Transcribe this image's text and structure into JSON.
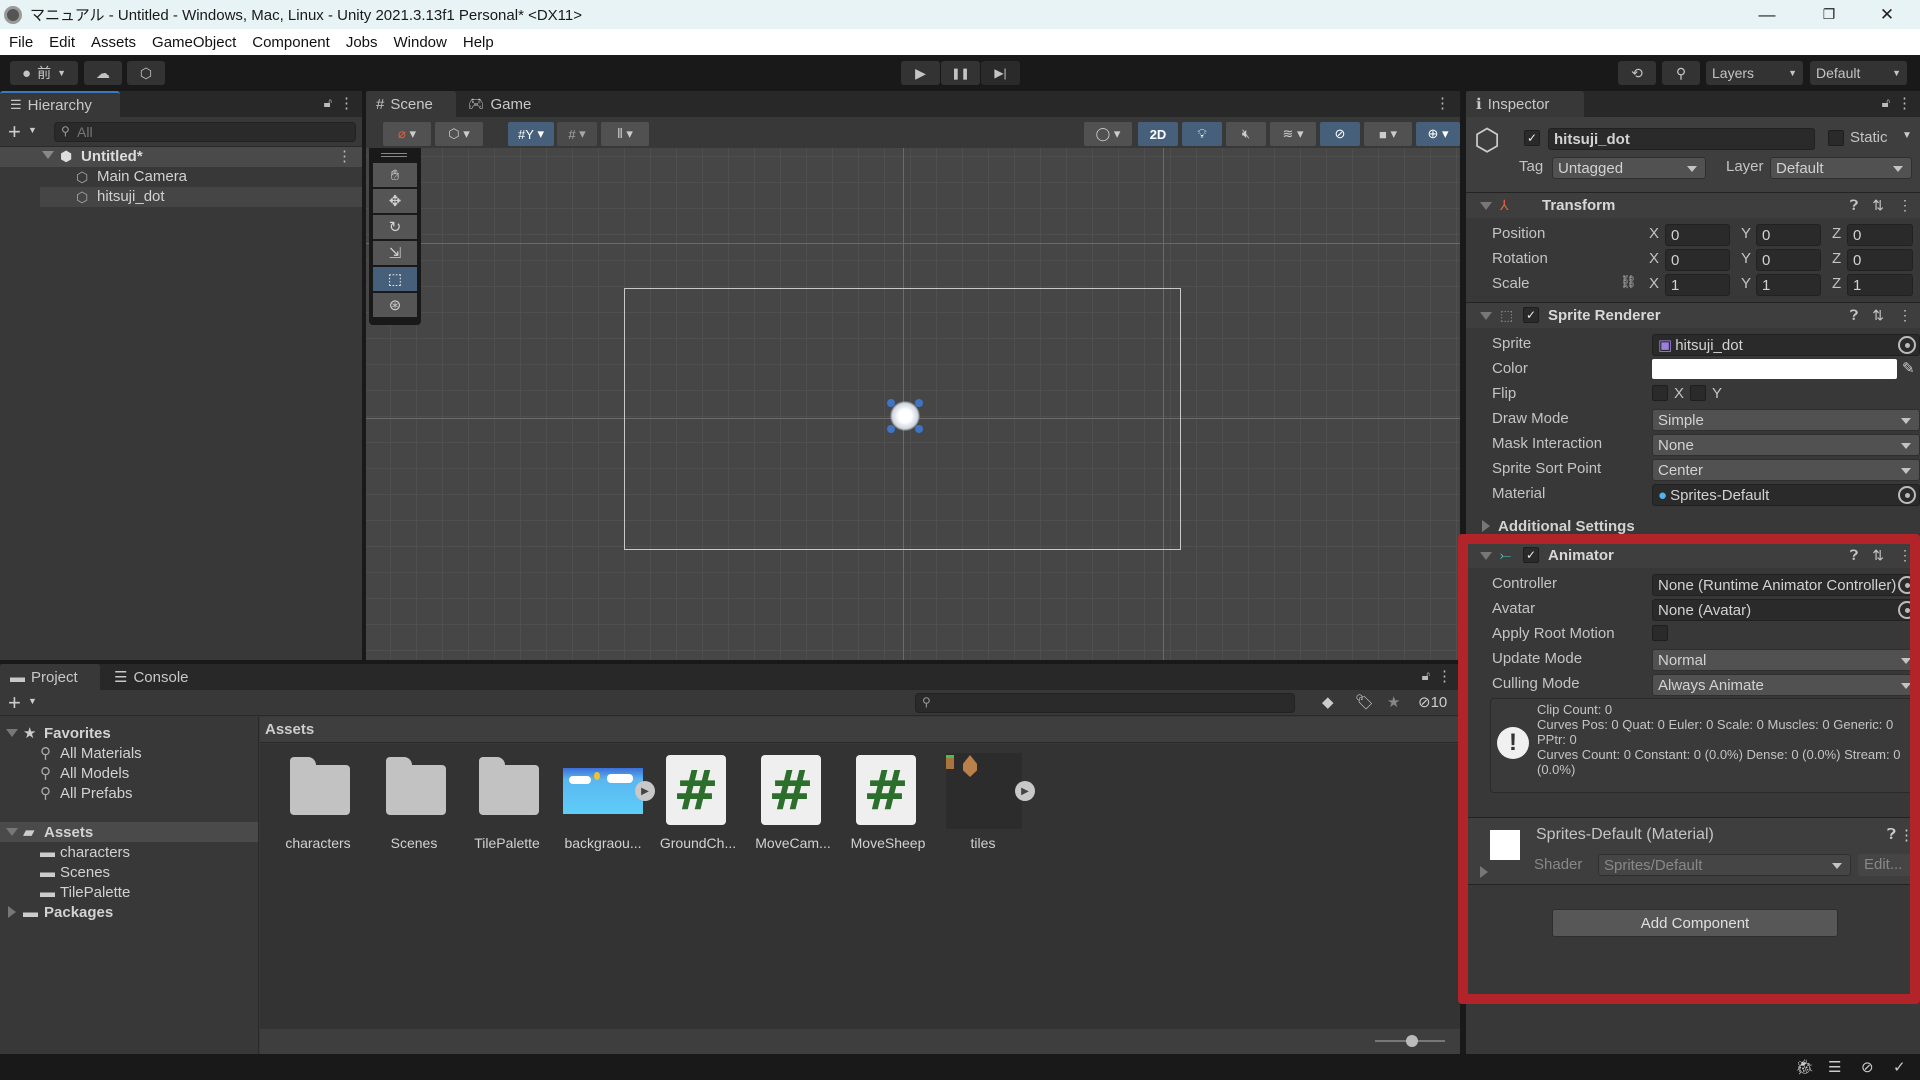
{
  "window": {
    "title": "マニュアル - Untitled - Windows, Mac, Linux - Unity 2021.3.13f1 Personal* <DX11>",
    "controls": {
      "minimize": "—",
      "restore": "❐",
      "close": "✕"
    }
  },
  "menu": [
    "File",
    "Edit",
    "Assets",
    "GameObject",
    "Component",
    "Jobs",
    "Window",
    "Help"
  ],
  "toolbar": {
    "account_label": "前",
    "play": "▶",
    "pause": "❚❚",
    "step": "▶|",
    "layers_label": "Layers",
    "layout_label": "Default"
  },
  "hierarchy": {
    "tab_label": "Hierarchy",
    "search_placeholder": "All",
    "scene_name": "Untitled*",
    "items": [
      "Main Camera",
      "hitsuji_dot"
    ]
  },
  "scene": {
    "tabs": [
      "Scene",
      "Game"
    ],
    "toggle_2d": "2D"
  },
  "project": {
    "tabs": [
      "Project",
      "Console"
    ],
    "hidden_count": "10",
    "favorites_label": "Favorites",
    "favorites": [
      "All Materials",
      "All Models",
      "All Prefabs"
    ],
    "assets_root": "Assets",
    "asset_folders": [
      "characters",
      "Scenes",
      "TilePalette"
    ],
    "packages_label": "Packages",
    "breadcrumb": "Assets",
    "grid_items": [
      {
        "name": "characters",
        "type": "folder"
      },
      {
        "name": "Scenes",
        "type": "folder"
      },
      {
        "name": "TilePalette",
        "type": "folder"
      },
      {
        "name": "backgraou...",
        "type": "sprite"
      },
      {
        "name": "GroundCh...",
        "type": "script"
      },
      {
        "name": "MoveCam...",
        "type": "script"
      },
      {
        "name": "MoveSheep",
        "type": "script"
      },
      {
        "name": "tiles",
        "type": "sprite"
      }
    ]
  },
  "inspector": {
    "tab_label": "Inspector",
    "object_name": "hitsuji_dot",
    "static_label": "Static",
    "tag_label": "Tag",
    "tag_value": "Untagged",
    "layer_label": "Layer",
    "layer_value": "Default",
    "transform": {
      "title": "Transform",
      "rows": [
        {
          "label": "Position",
          "x": "0",
          "y": "0",
          "z": "0"
        },
        {
          "label": "Rotation",
          "x": "0",
          "y": "0",
          "z": "0"
        },
        {
          "label": "Scale",
          "x": "1",
          "y": "1",
          "z": "1"
        }
      ]
    },
    "sprite_renderer": {
      "title": "Sprite Renderer",
      "sprite_label": "Sprite",
      "sprite_value": "hitsuji_dot",
      "color_label": "Color",
      "color_value": "#ffffff",
      "flip_label": "Flip",
      "flip_x": "X",
      "flip_y": "Y",
      "draw_mode_label": "Draw Mode",
      "draw_mode_value": "Simple",
      "mask_label": "Mask Interaction",
      "mask_value": "None",
      "sort_label": "Sprite Sort Point",
      "sort_value": "Center",
      "material_label": "Material",
      "material_value": "Sprites-Default",
      "additional_label": "Additional Settings"
    },
    "animator": {
      "title": "Animator",
      "controller_label": "Controller",
      "controller_value": "None (Runtime Animator Controller)",
      "avatar_label": "Avatar",
      "avatar_value": "None (Avatar)",
      "root_motion_label": "Apply Root Motion",
      "update_mode_label": "Update Mode",
      "update_mode_value": "Normal",
      "culling_label": "Culling Mode",
      "culling_value": "Always Animate",
      "info_lines": [
        "Clip Count: 0",
        "Curves Pos: 0 Quat: 0 Euler: 0 Scale: 0 Muscles: 0 Generic: 0 PPtr: 0",
        "Curves Count: 0 Constant: 0 (0.0%) Dense: 0 (0.0%) Stream: 0 (0.0%)"
      ]
    },
    "material": {
      "title": "Sprites-Default (Material)",
      "shader_label": "Shader",
      "shader_value": "Sprites/Default",
      "edit_label": "Edit..."
    },
    "add_component_label": "Add Component"
  },
  "highlight_color": "#b2242a"
}
